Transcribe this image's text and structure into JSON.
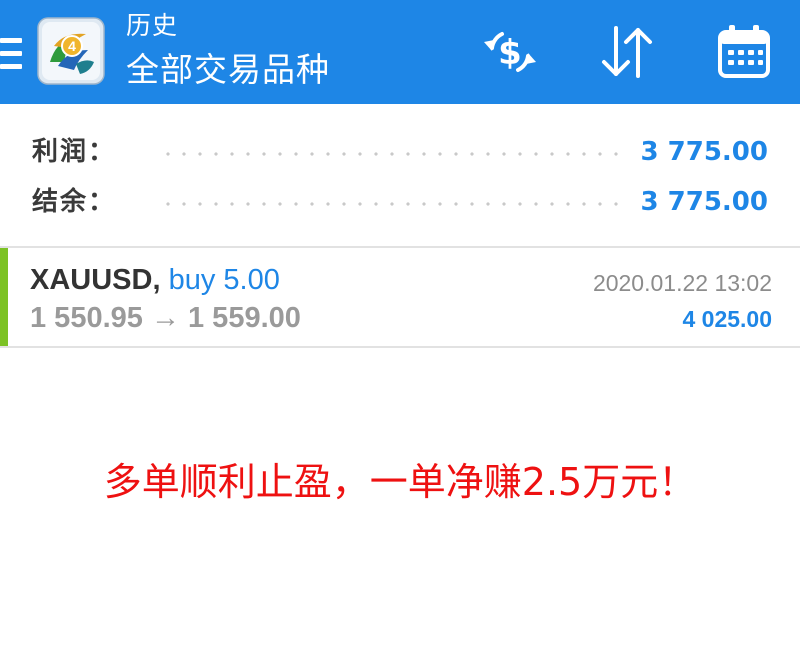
{
  "header": {
    "title": "历史",
    "subtitle": "全部交易品种",
    "icons": [
      "menu-icon",
      "metatrader-logo",
      "currency-exchange-icon",
      "sort-icon",
      "calendar-icon"
    ]
  },
  "summary": {
    "profit_label": "利润：",
    "profit_value": "3 775.00",
    "balance_label": "结余：",
    "balance_value": "3 775.00"
  },
  "trade": {
    "symbol": "XAUUSD,",
    "side": "buy 5.00",
    "prices": "1 550.95 → 1 559.00",
    "time": "2020.01.22 13:02",
    "profit": "4 025.00"
  },
  "caption": "多单顺利止盈，一单净赚2.5万元！",
  "colors": {
    "appbar": "#1e86e6",
    "value_blue": "#1e86e6",
    "accent_green": "#7cc225",
    "caption_red": "#ee1111"
  }
}
